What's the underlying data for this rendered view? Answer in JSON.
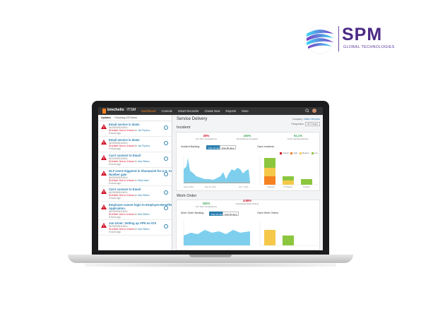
{
  "brand": {
    "name": "SPM",
    "tagline": "GLOBAL TECHNOLOGIES"
  },
  "colors": {
    "accent": "#f58220",
    "link": "#2a7fb0",
    "danger": "#d0021b",
    "success": "#3aa657",
    "topbar": "#323232"
  },
  "app": {
    "logo": "bmchelix",
    "product": "ITSM",
    "nav": [
      "Dashboard",
      "Console",
      "Smart Recorder",
      "Create New",
      "Reports",
      "More"
    ],
    "icons": [
      "search-icon",
      "user-avatar"
    ]
  },
  "feed": {
    "tab_updates": "Updates",
    "filter": "Following 200 items",
    "items": [
      {
        "title": "Email service is down",
        "id": "INC000000114514",
        "sla": "SLA Alert: Due in 4 hours",
        "by_label": "for",
        "person": "Jan Plynkov",
        "time": "6 hours ago"
      },
      {
        "title": "Email service is down",
        "id": "INC000000114514",
        "sla": "SLA Alert: Due in 4 hours",
        "by_label": "for",
        "person": "Jan Plynkov",
        "time": "6 hours ago"
      },
      {
        "title": "Can't connect to Email",
        "id": "INC000000114514",
        "sla": "SLA Alert: Due in 4 hours",
        "by_label": "for",
        "person": "Alan Wilson",
        "time": "6 hours ago"
      },
      {
        "title": "DLF event triggered in Sharepoint for U.S. Account",
        "title2": "Number gaio",
        "id": "INC000000114514",
        "sla": "SLA Alert: Due in 4 hours",
        "by_label": "for",
        "person": "Mary Mann",
        "time": "6 hours ago"
      },
      {
        "title": "Can't connect to Email",
        "id": "INC000000114514",
        "sla": "SLA Alert: Due in 4 hours",
        "by_label": "for",
        "person": "Alan Wilson",
        "time": "6 hours ago"
      },
      {
        "title": "Employee cannot login to Employee Benefits",
        "title2": "Application.",
        "id": "INC000000114514",
        "sla": "SLA Alert: Due in 4 hours",
        "by_label": "for",
        "person": "Alan Wilson",
        "time": "6 hours ago"
      },
      {
        "title": "Jon Urner: Setting up VPN on iOS",
        "id": "INC000000114514",
        "sla": "SLA Alert: Due in 4 hours",
        "by_label": "for",
        "person": "Alan Wilson",
        "time": "6 hours ago"
      }
    ]
  },
  "main": {
    "title": "Service Delivery",
    "company_label": "Company:",
    "company_value": "Calbro Services",
    "perspective_label": "Perspective:",
    "perspective_value": "All Groups",
    "incident": {
      "title": "Incident",
      "kpis": [
        {
          "value": "25%",
          "label": "On-Time Completions",
          "color": "#d0021b"
        },
        {
          "value": "100%",
          "label": "Resolutions Accepted",
          "color": "#3aa657"
        },
        {
          "value": "61.1%",
          "label": "First-Call Resolutions",
          "color": "#3aa657"
        }
      ],
      "backlog_title": "Incident Backlog",
      "range_a": "Past 30 days",
      "range_b": "Past 90 days",
      "x_start": "Sep 8, 2016",
      "x_mid": "Sep 13, 2016",
      "x_end": "Oct 7, 2016",
      "open_title": "Open Incidents",
      "open_cats": [
        "Assigned",
        "In Progress",
        "Pending"
      ],
      "legend": [
        "Critical",
        "High",
        "Medium",
        "Low"
      ]
    },
    "work_order": {
      "title": "Work Order",
      "kpis": [
        {
          "value": "4.55%",
          "label": "Scheduled Work Orders",
          "color": "#d0021b"
        },
        {
          "value": "100%",
          "label": "On-Time Completions",
          "color": "#3aa657"
        }
      ],
      "backlog_title": "Work Order Backlog",
      "range_a": "Past 30 days",
      "range_b": "Past 90 days",
      "open_title": "Open Work Orders"
    }
  }
}
